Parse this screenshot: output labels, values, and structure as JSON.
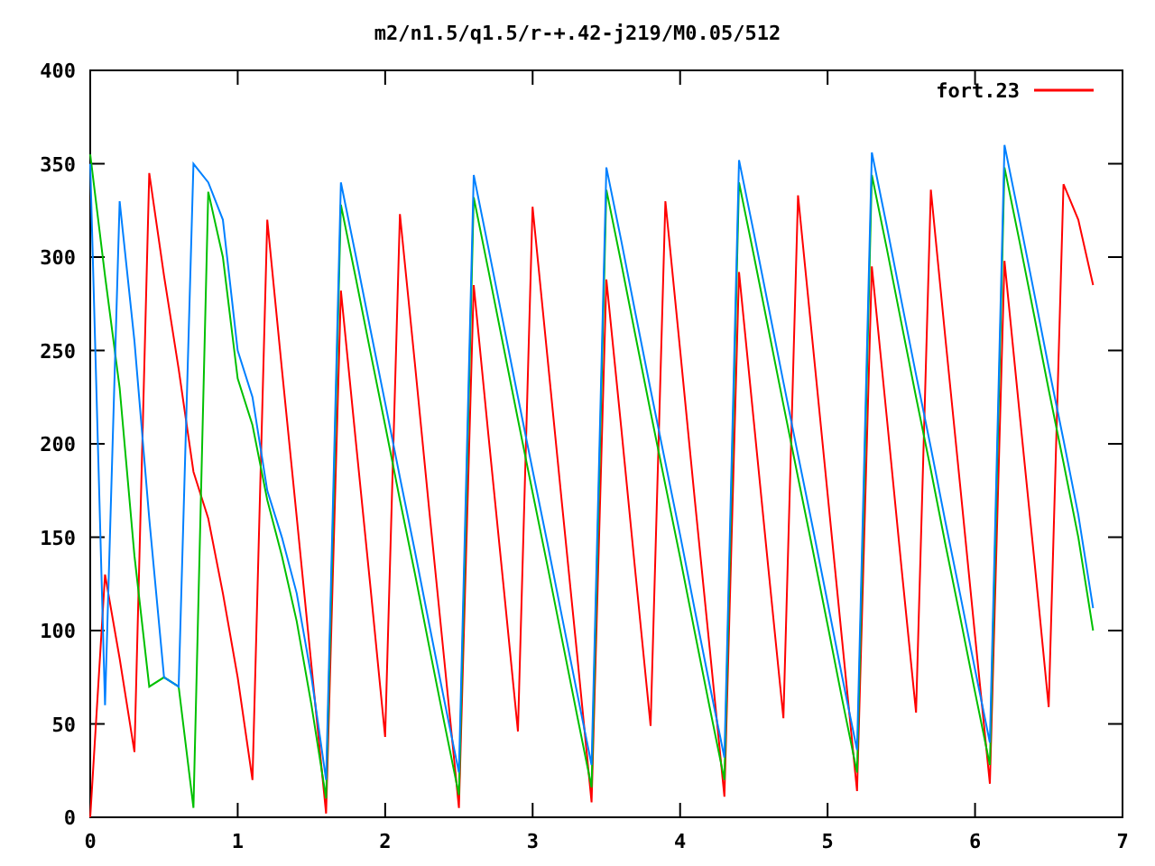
{
  "plot": {
    "chart_data": {
      "type": "line",
      "title": "m2/n1.5/q1.5/r-+.42-j219/M0.05/512",
      "x": [
        0,
        0.1,
        0.2,
        0.3,
        0.4,
        0.5,
        0.6,
        0.7,
        0.8,
        0.9,
        1,
        1.1,
        1.2,
        1.3,
        1.4,
        1.5,
        1.6,
        1.7,
        1.8,
        1.9,
        2,
        2.1,
        2.2,
        2.3,
        2.4,
        2.5,
        2.6,
        2.7,
        2.8,
        2.9,
        3,
        3.1,
        3.2,
        3.3,
        3.4,
        3.5,
        3.6,
        3.7,
        3.8,
        3.9,
        4,
        4.1,
        4.2,
        4.3,
        4.4,
        4.5,
        4.6,
        4.7,
        4.8,
        4.9,
        5,
        5.1,
        5.2,
        5.3,
        5.4,
        5.5,
        5.6,
        5.7,
        5.8,
        5.9,
        6,
        6.1,
        6.2,
        6.3,
        6.4,
        6.5,
        6.6,
        6.7,
        6.8
      ],
      "xlim": [
        0,
        7
      ],
      "ylim": [
        0,
        400
      ],
      "xticks": [
        0,
        1,
        2,
        3,
        4,
        5,
        6,
        7
      ],
      "yticks": [
        0,
        50,
        100,
        150,
        200,
        250,
        300,
        350,
        400
      ],
      "series": [
        {
          "name": "fort.23",
          "color": "#ff0000",
          "values": [
            0,
            130,
            85,
            35,
            345,
            290,
            240,
            185,
            160,
            120,
            75,
            20,
            320,
            240,
            161,
            81,
            2,
            282,
            202,
            123,
            43,
            323,
            244,
            164,
            85,
            5,
            285,
            205,
            126,
            46,
            327,
            247,
            167,
            88,
            8,
            288,
            209,
            129,
            49,
            330,
            250,
            170,
            91,
            11,
            292,
            212,
            132,
            53,
            333,
            253,
            173,
            94,
            14,
            295,
            215,
            135,
            56,
            336,
            256,
            177,
            97,
            18,
            298,
            218,
            139,
            59,
            339,
            320,
            285
          ]
        },
        {
          "color": "#00c000",
          "values": [
            355,
            290,
            230,
            140,
            70,
            75,
            70,
            5,
            335,
            300,
            235,
            210,
            170,
            140,
            105,
            60,
            10,
            328,
            289,
            249,
            210,
            170,
            131,
            91,
            51,
            12,
            332,
            293,
            253,
            213,
            174,
            135,
            95,
            55,
            16,
            336,
            297,
            257,
            217,
            178,
            139,
            99,
            59,
            20,
            340,
            301,
            261,
            221,
            182,
            143,
            103,
            63,
            24,
            344,
            305,
            265,
            225,
            186,
            146,
            107,
            67,
            28,
            348,
            309,
            269,
            229,
            190,
            150,
            100
          ]
        },
        {
          "color": "#0080ff",
          "values": [
            350,
            60,
            330,
            255,
            160,
            75,
            70,
            350,
            340,
            320,
            250,
            225,
            175,
            150,
            120,
            75,
            20,
            340,
            301,
            261,
            222,
            182,
            143,
            103,
            63,
            24,
            344,
            305,
            265,
            225,
            186,
            147,
            107,
            67,
            28,
            348,
            309,
            269,
            229,
            190,
            151,
            111,
            71,
            32,
            352,
            313,
            273,
            233,
            194,
            155,
            115,
            75,
            36,
            356,
            317,
            277,
            237,
            198,
            158,
            119,
            79,
            40,
            360,
            321,
            281,
            241,
            202,
            162,
            112
          ]
        }
      ]
    }
  }
}
